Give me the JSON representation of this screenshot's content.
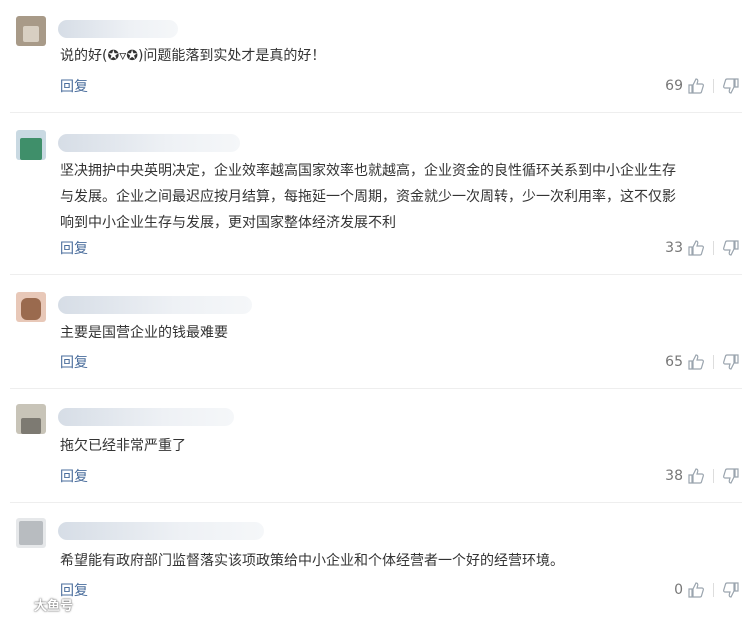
{
  "comments": [
    {
      "text_lines": [
        "说的好(✪▿✪)问题能落到实处才是真的好！"
      ],
      "reply_label": "回复",
      "likes": "69",
      "avatar_colors": [
        "#a89a88",
        "#d8cfc2"
      ]
    },
    {
      "text_lines": [
        "坚决拥护中央英明决定，企业效率越高国家效率也就越高，企业资金的良性循环关系到中小企业生存",
        "与发展。企业之间最迟应按月结算，每拖延一个周期，资金就少一次周转，少一次利用率，这不仅影",
        "响到中小企业生存与发展，更对国家整体经济发展不利"
      ],
      "reply_label": "回复",
      "likes": "33",
      "avatar_colors": [
        "#3f8f6a",
        "#c9d9e2"
      ]
    },
    {
      "text_lines": [
        "主要是国营企业的钱最难要"
      ],
      "reply_label": "回复",
      "likes": "65",
      "avatar_colors": [
        "#9a6a4e",
        "#e8c8b8"
      ]
    },
    {
      "text_lines": [
        "拖欠已经非常严重了"
      ],
      "reply_label": "回复",
      "likes": "38",
      "avatar_colors": [
        "#7d7a72",
        "#c8c4b8"
      ]
    },
    {
      "text_lines": [
        "希望能有政府部门监督落实该项政策给中小企业和个体经营者一个好的经营环境。"
      ],
      "reply_label": "回复",
      "likes": "0",
      "avatar_colors": [
        "#b8bcc0",
        "#e6e8ea"
      ]
    }
  ],
  "watermark": {
    "text": "大鱼号"
  }
}
